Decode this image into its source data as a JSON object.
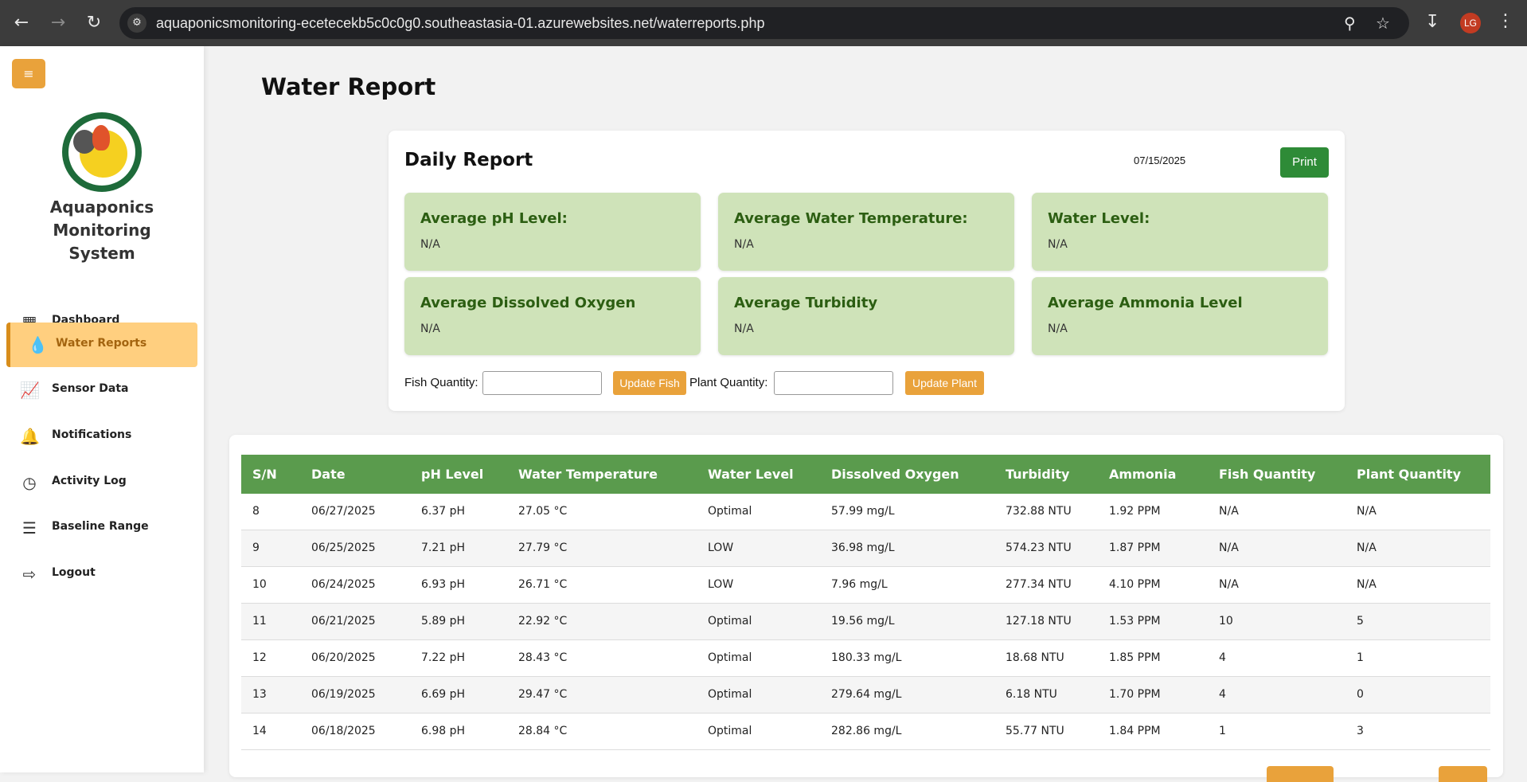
{
  "browser": {
    "url": "aquaponicsmonitoring-ecetecekb5c0c0g0.southeastasia-01.azurewebsites.net/waterreports.php",
    "profile_initials": "LG"
  },
  "sidebar": {
    "menu_icon": "≡",
    "brand_line1": "Aquaponics Monitoring",
    "brand_line2": "System",
    "items": [
      {
        "label": "Dashboard",
        "icon": "dashboard-icon"
      },
      {
        "label": "Water Reports",
        "icon": "water-drop-icon"
      },
      {
        "label": "Sensor Data",
        "icon": "chart-icon"
      },
      {
        "label": "Notifications",
        "icon": "bell-icon"
      },
      {
        "label": "Activity Log",
        "icon": "clock-icon"
      },
      {
        "label": "Baseline Range",
        "icon": "sliders-icon"
      },
      {
        "label": "Logout",
        "icon": "logout-icon"
      }
    ],
    "active_item": "Water Reports"
  },
  "main": {
    "title": "Water Report",
    "daily_report": {
      "title": "Daily Report",
      "date": "07/15/2025",
      "print_label": "Print",
      "stats": [
        {
          "label": "Average pH Level:",
          "value": "N/A"
        },
        {
          "label": "Average Water Temperature:",
          "value": "N/A"
        },
        {
          "label": "Water Level:",
          "value": "N/A"
        },
        {
          "label": "Average Dissolved Oxygen",
          "value": "N/A"
        },
        {
          "label": "Average Turbidity",
          "value": "N/A"
        },
        {
          "label": "Average Ammonia Level",
          "value": "N/A"
        }
      ],
      "fish_quantity_label": "Fish Quantity:",
      "fish_quantity_value": "",
      "update_fish_label": "Update Fish",
      "plant_quantity_label": "Plant Quantity:",
      "plant_quantity_value": "",
      "update_plant_label": "Update Plant"
    },
    "table": {
      "columns": [
        "S/N",
        "Date",
        "pH Level",
        "Water Temperature",
        "Water Level",
        "Dissolved Oxygen",
        "Turbidity",
        "Ammonia",
        "Fish Quantity",
        "Plant Quantity"
      ],
      "rows": [
        [
          "8",
          "06/27/2025",
          "6.37 pH",
          "27.05 °C",
          "Optimal",
          "57.99 mg/L",
          "732.88 NTU",
          "1.92 PPM",
          "N/A",
          "N/A"
        ],
        [
          "9",
          "06/25/2025",
          "7.21 pH",
          "27.79 °C",
          "LOW",
          "36.98 mg/L",
          "574.23 NTU",
          "1.87 PPM",
          "N/A",
          "N/A"
        ],
        [
          "10",
          "06/24/2025",
          "6.93 pH",
          "26.71 °C",
          "LOW",
          "7.96 mg/L",
          "277.34 NTU",
          "4.10 PPM",
          "N/A",
          "N/A"
        ],
        [
          "11",
          "06/21/2025",
          "5.89 pH",
          "22.92 °C",
          "Optimal",
          "19.56 mg/L",
          "127.18 NTU",
          "1.53 PPM",
          "10",
          "5"
        ],
        [
          "12",
          "06/20/2025",
          "7.22 pH",
          "28.43 °C",
          "Optimal",
          "180.33 mg/L",
          "18.68 NTU",
          "1.85 PPM",
          "4",
          "1"
        ],
        [
          "13",
          "06/19/2025",
          "6.69 pH",
          "29.47 °C",
          "Optimal",
          "279.64 mg/L",
          "6.18 NTU",
          "1.70 PPM",
          "4",
          "0"
        ],
        [
          "14",
          "06/18/2025",
          "6.98 pH",
          "28.84 °C",
          "Optimal",
          "282.86 mg/L",
          "55.77 NTU",
          "1.84 PPM",
          "1",
          "3"
        ]
      ]
    }
  },
  "colors": {
    "accent": "#e9a23b",
    "table_header": "#5a9b4d",
    "stat_card": "#cfe3b9",
    "print_button": "#2e8b37"
  }
}
